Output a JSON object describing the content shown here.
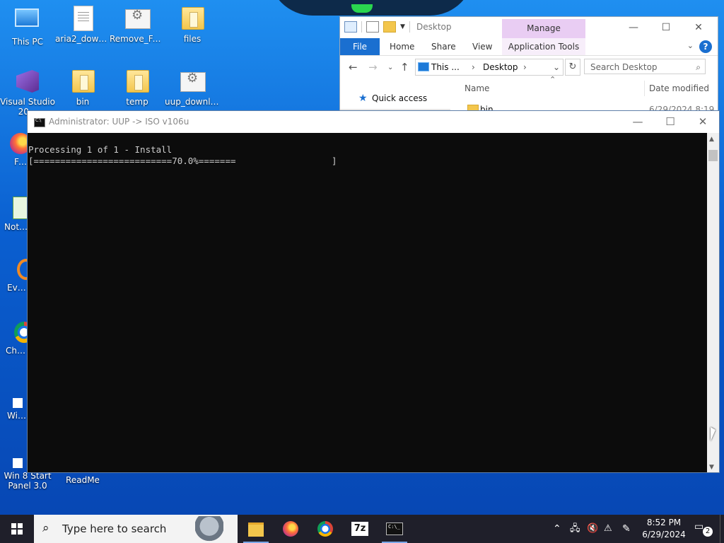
{
  "desktop": {
    "icons": [
      {
        "label": "This PC"
      },
      {
        "label": "aria2_down..."
      },
      {
        "label": "Remove_Fai..."
      },
      {
        "label": "files"
      },
      {
        "label": "Visual Studio 20..."
      },
      {
        "label": "bin"
      },
      {
        "label": "temp"
      },
      {
        "label": "uup_downloa"
      },
      {
        "label": "Fire..."
      },
      {
        "label": "Notep..."
      },
      {
        "label": "Every..."
      },
      {
        "label": "Chrom..."
      },
      {
        "label": "WinN..."
      },
      {
        "label": "Win 8 Start Panel 3.0"
      },
      {
        "label": "ReadMe"
      }
    ]
  },
  "explorer": {
    "title": "Desktop",
    "manage_tab": "Manage",
    "ribbon_tabs": [
      "File",
      "Home",
      "Share",
      "View",
      "Application Tools"
    ],
    "address": {
      "crumb1": "This ...",
      "crumb2": "Desktop"
    },
    "search_placeholder": "Search Desktop",
    "nav": {
      "quick_access": "Quick access"
    },
    "columns": {
      "name": "Name",
      "date": "Date modified"
    },
    "rows": [
      {
        "name": "bin",
        "date": "6/29/2024 8:19"
      }
    ]
  },
  "console": {
    "title": "Administrator:  UUP -> ISO v106u",
    "lines": [
      "Processing 1 of 1 - Install",
      "[==========================70.0%=======                  ]"
    ],
    "progress_percent": 70.0
  },
  "taskbar": {
    "search_placeholder": "Type here to search",
    "clock_time": "8:52 PM",
    "clock_date": "6/29/2024",
    "notification_count": "2"
  },
  "colors": {
    "file_tab": "#1a6fd0",
    "manage_tab": "#e9cdf3",
    "console_bg": "#0c0c0c",
    "console_text": "#cccccc",
    "taskbar_bg": "#1f1f2a"
  }
}
